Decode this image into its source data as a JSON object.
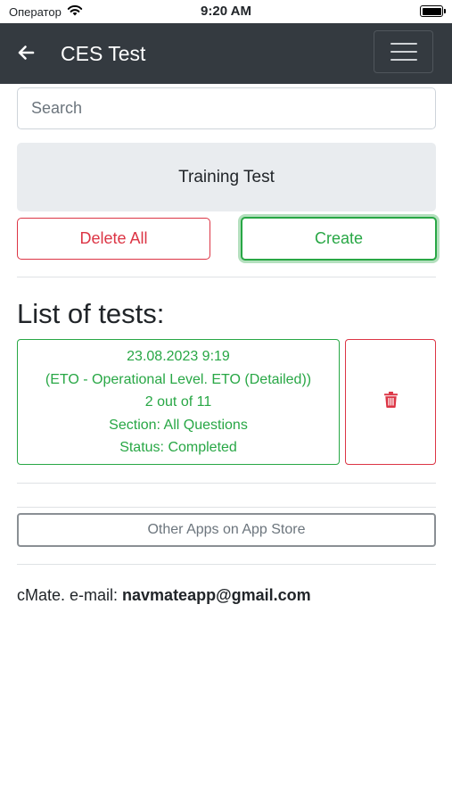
{
  "status_bar": {
    "carrier": "Оператор",
    "time": "9:20 AM"
  },
  "navbar": {
    "title": "CES Test"
  },
  "search": {
    "placeholder": "Search"
  },
  "training_test_label": "Training Test",
  "actions": {
    "delete_all_label": "Delete All",
    "create_label": "Create"
  },
  "list_heading": "List of tests:",
  "tests": [
    {
      "date": "23.08.2023 9:19",
      "name": "(ETO - Operational Level. ETO (Detailed))",
      "score": "2 out of 11",
      "section": "Section: All Questions",
      "status": "Status: Completed"
    }
  ],
  "other_apps_label": "Other Apps on App Store",
  "footer": {
    "contact_prefix": "cMate. e-mail: ",
    "email": "navmateapp@gmail.com"
  },
  "colors": {
    "navbar_bg": "#343a40",
    "success": "#28a745",
    "danger": "#dc3545",
    "muted_bg": "#e9ecef"
  },
  "icons": {
    "back": "arrow-left-icon",
    "menu": "hamburger-icon",
    "delete": "trash-icon",
    "wifi": "wifi-icon",
    "battery": "battery-icon"
  }
}
